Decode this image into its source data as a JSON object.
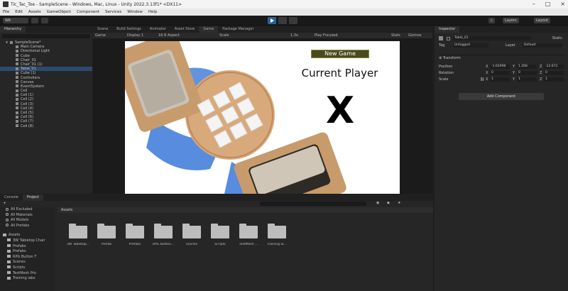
{
  "window": {
    "title": "Tic_Tac_Toe - SampleScene - Windows, Mac, Linux - Unity 2022.3.13f1* <DX11>"
  },
  "menu": [
    "File",
    "Edit",
    "Assets",
    "GameObject",
    "Component",
    "Services",
    "Window",
    "Help"
  ],
  "toolbar": {
    "account": "WA",
    "layers": "Layers",
    "layout": "Layout"
  },
  "hierarchy": {
    "tab": "Hierarchy",
    "items": [
      {
        "label": "SampleScene*",
        "depth": 0,
        "expanded": true
      },
      {
        "label": "Main Camera",
        "depth": 1
      },
      {
        "label": "Directional Light",
        "depth": 1
      },
      {
        "label": "Cube",
        "depth": 1
      },
      {
        "label": "Chair_01",
        "depth": 1
      },
      {
        "label": "Chair_01 (1)",
        "depth": 1
      },
      {
        "label": "Table_01",
        "depth": 1,
        "selected": true
      },
      {
        "label": "Cube (1)",
        "depth": 1
      },
      {
        "label": "Controllers",
        "depth": 1
      },
      {
        "label": "Canvas",
        "depth": 1
      },
      {
        "label": "EventSystem",
        "depth": 1
      },
      {
        "label": "Cell",
        "depth": 1
      },
      {
        "label": "Cell (1)",
        "depth": 1
      },
      {
        "label": "Cell (2)",
        "depth": 1
      },
      {
        "label": "Cell (3)",
        "depth": 1
      },
      {
        "label": "Cell (4)",
        "depth": 1
      },
      {
        "label": "Cell (5)",
        "depth": 1
      },
      {
        "label": "Cell (6)",
        "depth": 1
      },
      {
        "label": "Cell (7)",
        "depth": 1
      },
      {
        "label": "Cell (8)",
        "depth": 1
      }
    ]
  },
  "center": {
    "tabs": [
      "Scene",
      "Build Settings",
      "Animator",
      "Asset Store",
      "Game",
      "Package Manager"
    ],
    "active_tab": "Game",
    "gamebar": {
      "mode": "Game",
      "display": "Display 1",
      "aspect": "16:9 Aspect",
      "scale": "Scale",
      "scale_value": "1.3x",
      "play_focused": "Play Focused",
      "stats": "Stats",
      "gizmos": "Gizmos"
    },
    "game": {
      "new_game": "New Game",
      "current_player_label": "Current Player",
      "current_player": "X"
    }
  },
  "inspector": {
    "tab": "Inspector",
    "object_name": "Table_01",
    "static_label": "Static",
    "tag_label": "Tag",
    "tag_value": "Untagged",
    "layer_label": "Layer",
    "layer_value": "Default",
    "component": "Transform",
    "position": {
      "label": "Position",
      "x": "-1.62098",
      "y": "1.268",
      "z": "-12.672"
    },
    "rotation": {
      "label": "Rotation",
      "x": "0",
      "y": "0",
      "z": "0"
    },
    "scale": {
      "label": "Scale",
      "x": "1",
      "y": "1",
      "z": "1"
    },
    "add_component": "Add Component"
  },
  "project": {
    "tabs": [
      "Console",
      "Project"
    ],
    "active_tab": "Project",
    "favorites": [
      "All Excluded",
      "All Materials",
      "All Models",
      "All Prefabs"
    ],
    "tree": [
      "Assets",
      "3W Tabletop Chair",
      "Prefabs",
      "Prefabs",
      "RPG Button T",
      "Scenes",
      "Scripts",
      "TextMesh Pro",
      "Training labs"
    ],
    "breadcrumb": "Assets",
    "folders": [
      "3W Tabletop...",
      "Prefab",
      "Prefabs",
      "RPG Button...",
      "Scenes",
      "Scripts",
      "TextMesh ...",
      "Training la..."
    ]
  }
}
